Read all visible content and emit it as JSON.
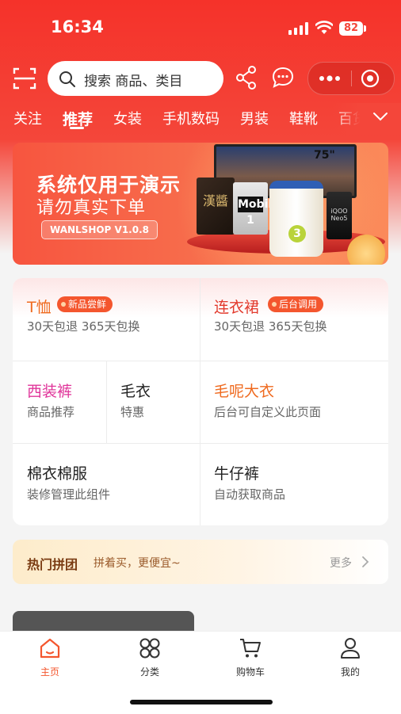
{
  "status_bar": {
    "time": "16:34",
    "battery": "82"
  },
  "header": {
    "search_placeholder": "搜索 商品、类目",
    "icons": {
      "scan": "scan-icon",
      "share": "share-icon",
      "message": "message-icon",
      "more": "more-dots-icon",
      "close": "capsule-close-icon"
    }
  },
  "tabs": [
    "关注",
    "推荐",
    "女装",
    "手机数码",
    "男装",
    "鞋靴",
    "百货"
  ],
  "active_tab": "推荐",
  "banner": {
    "title": "系统仅用于演示",
    "subtitle": "请勿真实下单",
    "version": "WANLSHOP V1.0.8",
    "tv_size": "75\"",
    "product_labels": {
      "box1": "漢醬",
      "box2": "Mobil 1",
      "can_badge": "3",
      "box3": "iQOO Neo5"
    }
  },
  "categories": {
    "tshirt": {
      "title": "T恤",
      "tag": "新品尝鲜",
      "sub": "30天包退 365天包换"
    },
    "dress": {
      "title": "连衣裙",
      "tag": "后台调用",
      "sub": "30天包退 365天包换"
    },
    "suit_pants": {
      "title": "西装裤",
      "sub": "商品推荐"
    },
    "sweater": {
      "title": "毛衣",
      "sub": "特惠"
    },
    "coat": {
      "title": "毛呢大衣",
      "sub": "后台可自定义此页面"
    },
    "cotton": {
      "title": "棉衣棉服",
      "sub": "装修管理此组件"
    },
    "jeans": {
      "title": "牛仔裤",
      "sub": "自动获取商品"
    }
  },
  "group_buy": {
    "title": "热门拼团",
    "subtitle": "拼着买，更便宜~",
    "more": "更多"
  },
  "tabbar": [
    {
      "label": "主页",
      "icon": "home-icon",
      "active": true
    },
    {
      "label": "分类",
      "icon": "category-icon",
      "active": false
    },
    {
      "label": "购物车",
      "icon": "cart-icon",
      "active": false
    },
    {
      "label": "我的",
      "icon": "profile-icon",
      "active": false
    }
  ],
  "colors": {
    "brand": "#f4463a",
    "accent": "#f4562e",
    "pink": "#e0359a",
    "orange": "#ef6a1f"
  }
}
